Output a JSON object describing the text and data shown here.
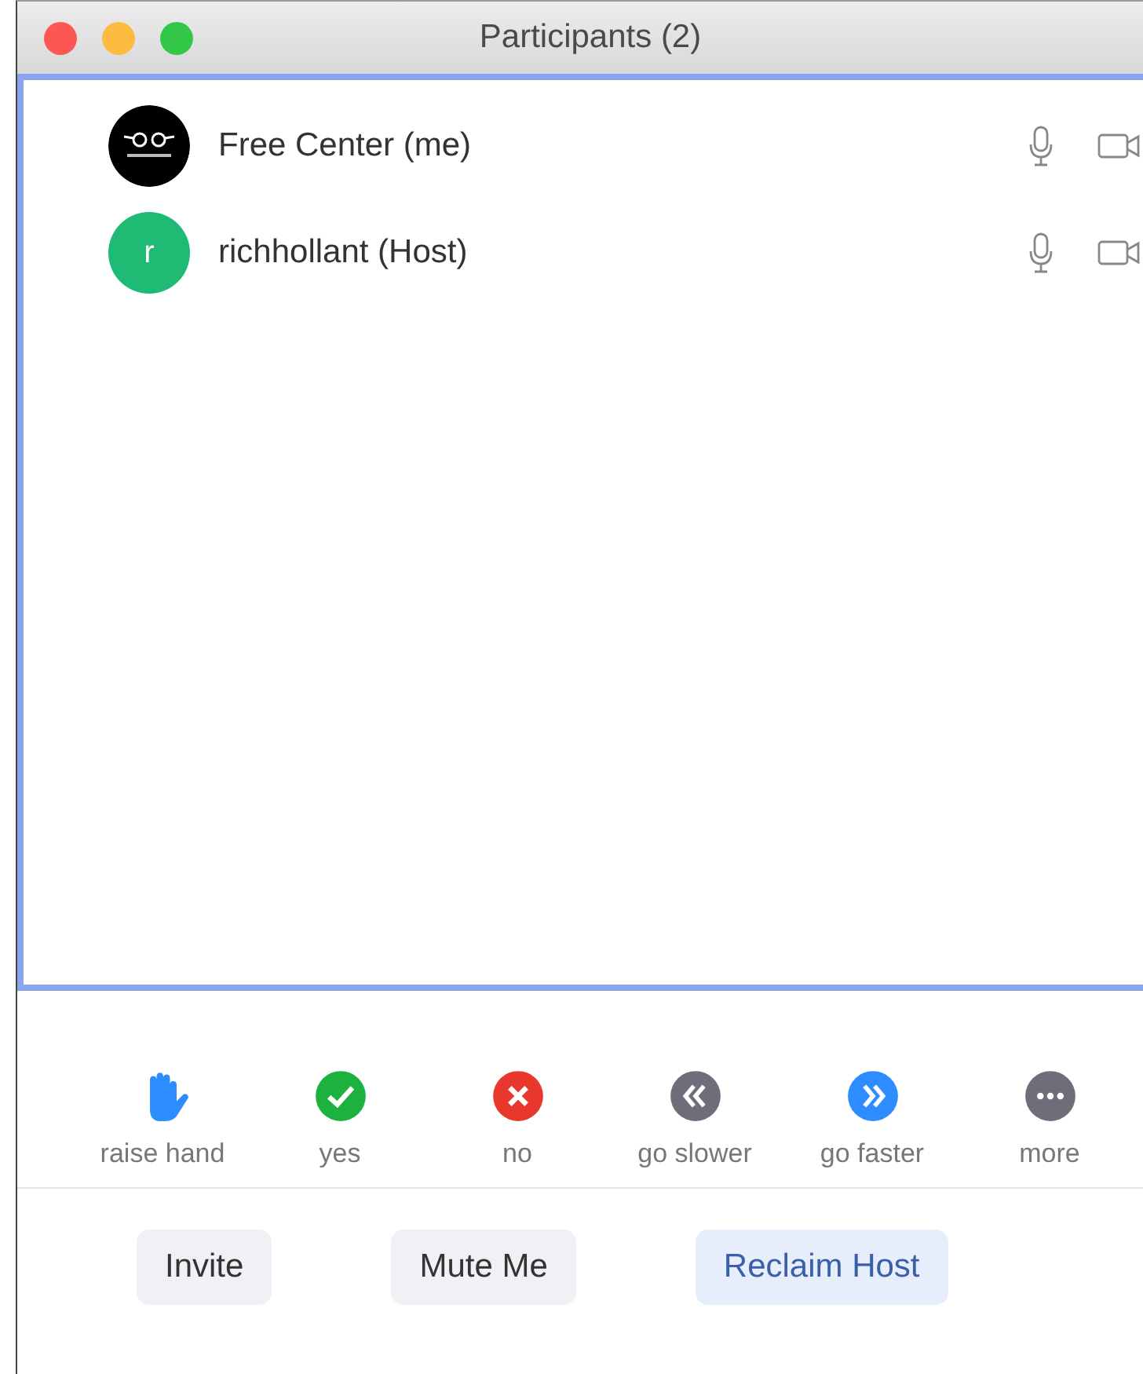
{
  "window": {
    "title": "Participants (2)"
  },
  "participants": [
    {
      "name": "Free Center (me)",
      "avatar": {
        "kind": "logo"
      }
    },
    {
      "name": "richhollant (Host)",
      "avatar": {
        "kind": "initial",
        "initial": "r",
        "color": "#1fba74"
      }
    }
  ],
  "reactions": [
    {
      "kind": "hand",
      "label": "raise hand"
    },
    {
      "kind": "yes",
      "label": "yes"
    },
    {
      "kind": "no",
      "label": "no"
    },
    {
      "kind": "slower",
      "label": "go slower"
    },
    {
      "kind": "faster",
      "label": "go faster"
    },
    {
      "kind": "more",
      "label": "more"
    }
  ],
  "buttons": [
    {
      "label": "Invite",
      "kind": "plain"
    },
    {
      "label": "Mute Me",
      "kind": "plain"
    },
    {
      "label": "Reclaim Host",
      "kind": "primary"
    }
  ]
}
